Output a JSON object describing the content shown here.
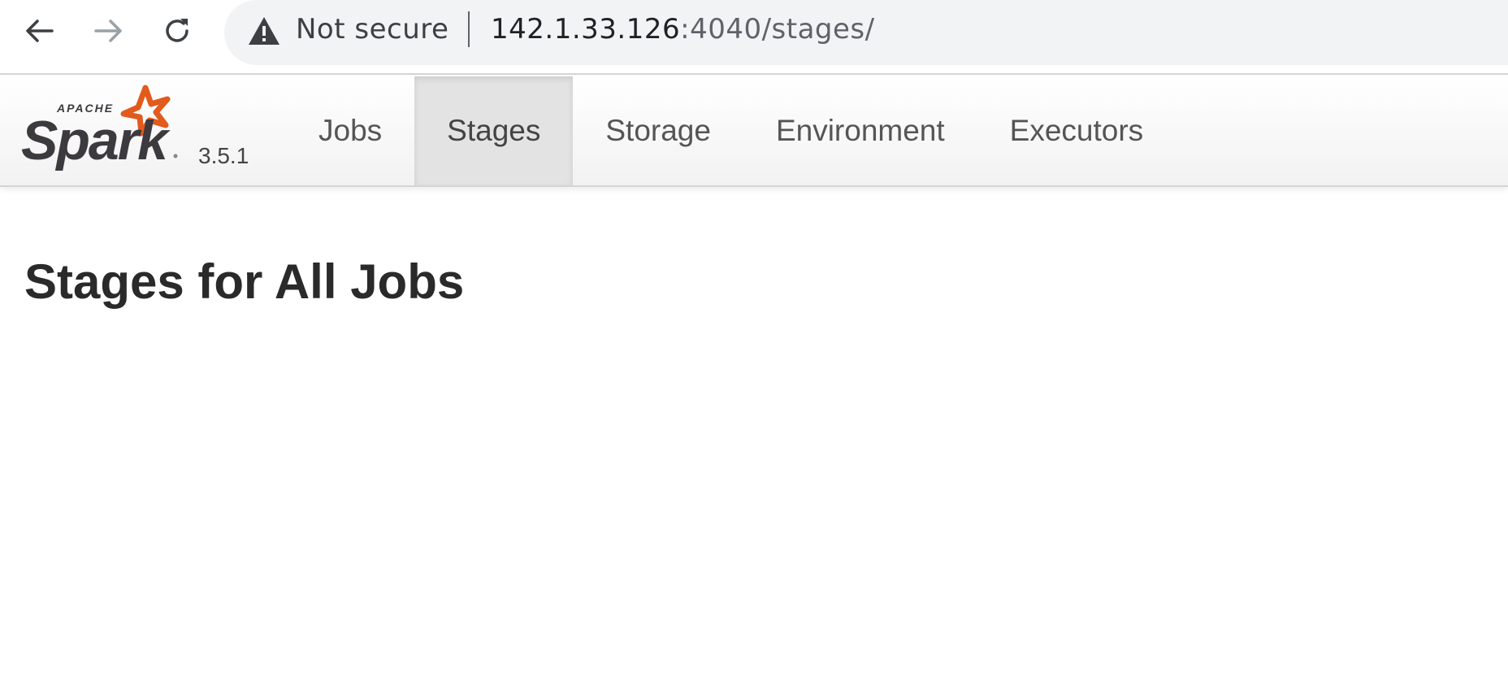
{
  "browser": {
    "security_label": "Not secure",
    "url_host": "142.1.33.126",
    "url_path": ":4040/stages/",
    "icons": {
      "back": "back-arrow-icon",
      "forward": "forward-arrow-icon",
      "reload": "reload-icon",
      "security": "warning-triangle-icon"
    }
  },
  "navbar": {
    "brand_icon": "apache-spark-logo",
    "brand_logo_text": "Spark",
    "brand_logo_small": "APACHE",
    "version": "3.5.1",
    "tabs": [
      {
        "label": "Jobs",
        "active": false
      },
      {
        "label": "Stages",
        "active": true
      },
      {
        "label": "Storage",
        "active": false
      },
      {
        "label": "Environment",
        "active": false
      },
      {
        "label": "Executors",
        "active": false
      }
    ]
  },
  "main": {
    "title": "Stages for All Jobs"
  },
  "colors": {
    "spark_orange": "#e25a1c",
    "spark_dark": "#3c3a3e",
    "active_tab_bg": "#e3e3e3",
    "omnibox_bg": "#f1f3f4"
  }
}
